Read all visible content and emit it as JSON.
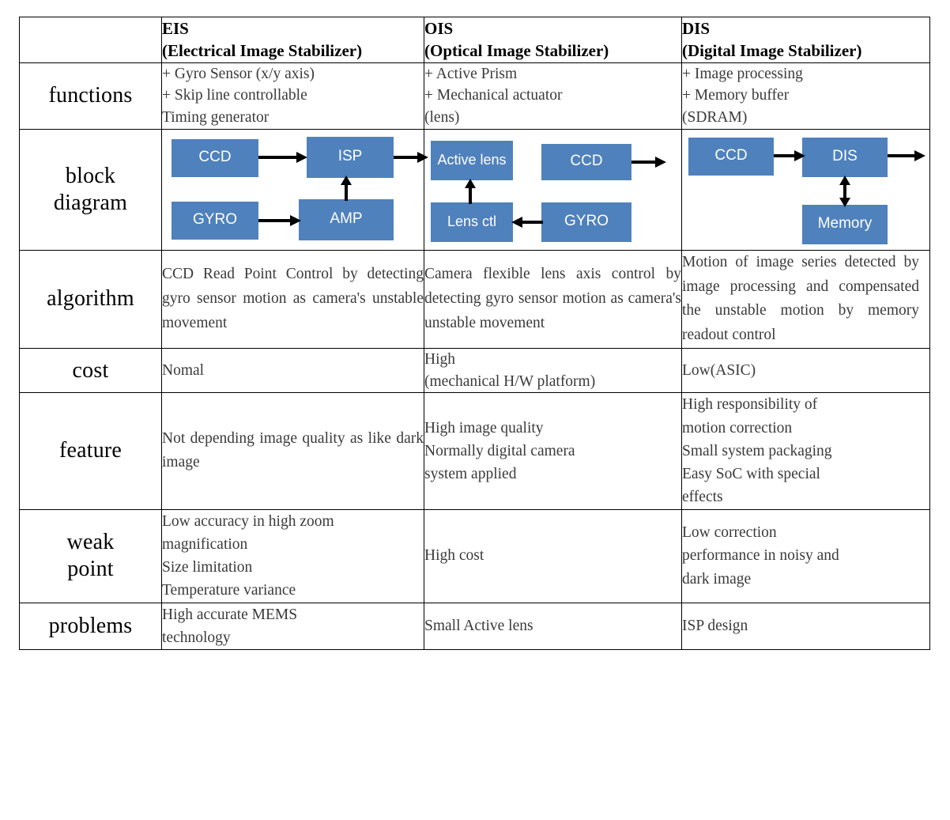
{
  "table": {
    "header": {
      "blank": "",
      "columns": [
        {
          "abbr": "EIS",
          "full": "(Electrical Image Stabilizer)"
        },
        {
          "abbr": "OIS",
          "full": "(Optical Image Stabilizer)"
        },
        {
          "abbr": "DIS",
          "full": "(Digital Image Stabilizer)"
        }
      ]
    },
    "rows": {
      "functions": {
        "label": "functions",
        "eis": {
          "l1": "+ Gyro Sensor (x/y axis)",
          "l2": "+ Skip line controllable",
          "l3": "Timing generator"
        },
        "ois": {
          "l1": "+ Active Prism",
          "l2": "+ Mechanical actuator",
          "l3": "(lens)"
        },
        "dis": {
          "l1": "+ Image processing",
          "l2": "+ Memory buffer",
          "l3": "(SDRAM)"
        }
      },
      "block_diagram": {
        "label_l1": "block",
        "label_l2": "diagram",
        "eis": {
          "ccd": "CCD",
          "isp": "ISP",
          "gyro": "GYRO",
          "amp": "AMP"
        },
        "ois": {
          "active_lens": "Active lens",
          "ccd": "CCD",
          "lens_ctl": "Lens ctl",
          "gyro": "GYRO"
        },
        "dis": {
          "ccd": "CCD",
          "dis": "DIS",
          "memory": "Memory"
        }
      },
      "algorithm": {
        "label": "algorithm",
        "eis": "CCD Read Point Control by detecting gyro sensor motion as camera's unstable movement",
        "ois": "Camera flexible lens axis control by detecting gyro sensor motion as camera's unstable movement",
        "dis": "Motion of image series detected by image processing and compensated the unstable motion by memory readout control"
      },
      "cost": {
        "label": "cost",
        "eis": {
          "l1": "Nomal",
          "l2": ""
        },
        "ois": {
          "l1": "High",
          "l2": "(mechanical H/W platform)"
        },
        "dis": {
          "l1": "Low(ASIC)",
          "l2": ""
        }
      },
      "feature": {
        "label": "feature",
        "eis": "Not depending image quality as like dark image",
        "ois": {
          "l1": "High image quality",
          "l2": "Normally digital camera",
          "l3": "system applied"
        },
        "dis": {
          "l1": "High responsibility of",
          "l2": "motion correction",
          "l3": "Small system packaging",
          "l4": "Easy SoC with special",
          "l5": "effects"
        }
      },
      "weak_point": {
        "label_l1": "weak",
        "label_l2": "point",
        "eis": {
          "l1": "Low accuracy in high zoom",
          "l2": "magnification",
          "l3": "Size limitation",
          "l4": "Temperature variance"
        },
        "ois": {
          "l1": "High cost"
        },
        "dis": {
          "l1": "Low correction",
          "l2": "performance in noisy and",
          "l3": "dark image"
        }
      },
      "problems": {
        "label": "problems",
        "eis": {
          "l1": "High accurate MEMS",
          "l2": "technology"
        },
        "ois": {
          "l1": "Small Active lens"
        },
        "dis": {
          "l1": "ISP design"
        }
      }
    }
  },
  "colors": {
    "block_fill": "#4f81bd",
    "block_text": "#ffffff",
    "border": "#000000",
    "body_text": "#3a3a3a"
  }
}
